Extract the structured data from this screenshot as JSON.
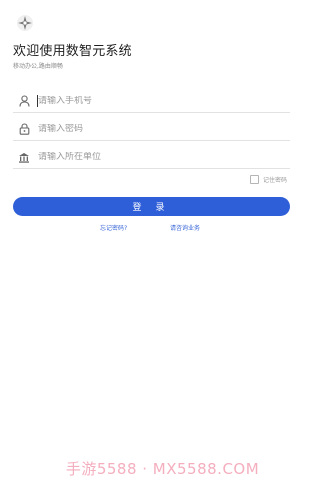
{
  "app": {
    "logo_icon": "sparkle-logo-icon",
    "title": "欢迎使用数智元系统",
    "subtitle": "移动办公,路由顺畅"
  },
  "form": {
    "phone": {
      "icon": "user-icon",
      "placeholder": "请输入手机号",
      "value": ""
    },
    "password": {
      "icon": "lock-icon",
      "placeholder": "请输入密码",
      "value": ""
    },
    "unit": {
      "icon": "building-icon",
      "placeholder": "请输入所在单位",
      "value": ""
    },
    "remember_label": "记住密码",
    "remember_checked": false,
    "login_label": "登录",
    "forgot_link": "忘记密码?",
    "contact_link": "请咨询业务"
  },
  "watermark": "手游5588 · MX5588.COM",
  "colors": {
    "accent": "#2f5fd8",
    "link": "#3a67d8",
    "watermark": "#f3a6b8"
  }
}
